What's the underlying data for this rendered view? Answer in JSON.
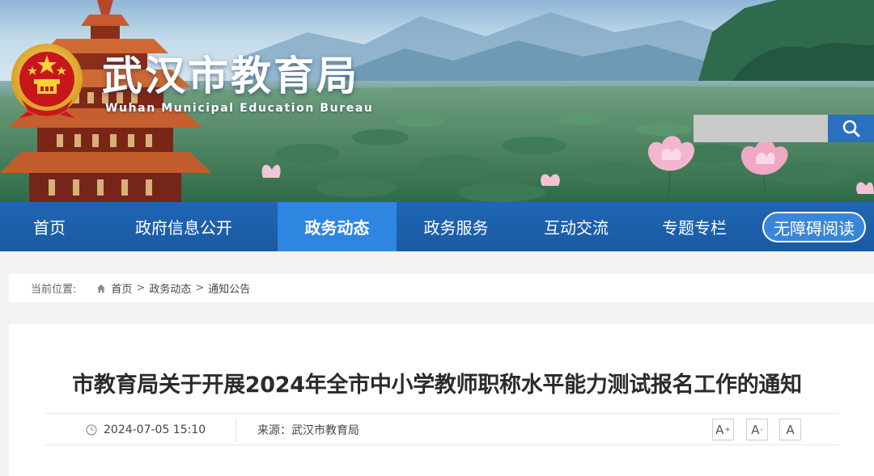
{
  "header": {
    "title": "武汉市教育局",
    "subtitle": "Wuhan Municipal Education Bureau",
    "search": {
      "placeholder": "",
      "value": "",
      "icon": "search-icon"
    }
  },
  "nav": {
    "items": [
      {
        "label": "首页",
        "active": false
      },
      {
        "label": "政府信息公开",
        "active": false
      },
      {
        "label": "政务动态",
        "active": true
      },
      {
        "label": "政务服务",
        "active": false
      },
      {
        "label": "互动交流",
        "active": false
      },
      {
        "label": "专题专栏",
        "active": false
      }
    ],
    "accessible_label": "无障碍阅读"
  },
  "breadcrumb": {
    "label": "当前位置:",
    "items": [
      "首页",
      "政务动态",
      "通知公告"
    ],
    "separator": ">"
  },
  "article": {
    "title": "市教育局关于开展2024年全市中小学教师职称水平能力测试报名工作的通知",
    "date": "2024-07-05 15:10",
    "source_label": "来源：",
    "source": "武汉市教育局",
    "font_controls": [
      {
        "label": "A",
        "sup": "+",
        "name": "font-increase"
      },
      {
        "label": "A",
        "sup": "-",
        "name": "font-decrease"
      },
      {
        "label": "A",
        "sup": "",
        "name": "font-reset"
      }
    ]
  },
  "colors": {
    "nav_bg": "#1f66b3",
    "nav_active": "#2e86e0",
    "search_button": "#2a6fc0",
    "page_bg": "#f2f3f5"
  }
}
